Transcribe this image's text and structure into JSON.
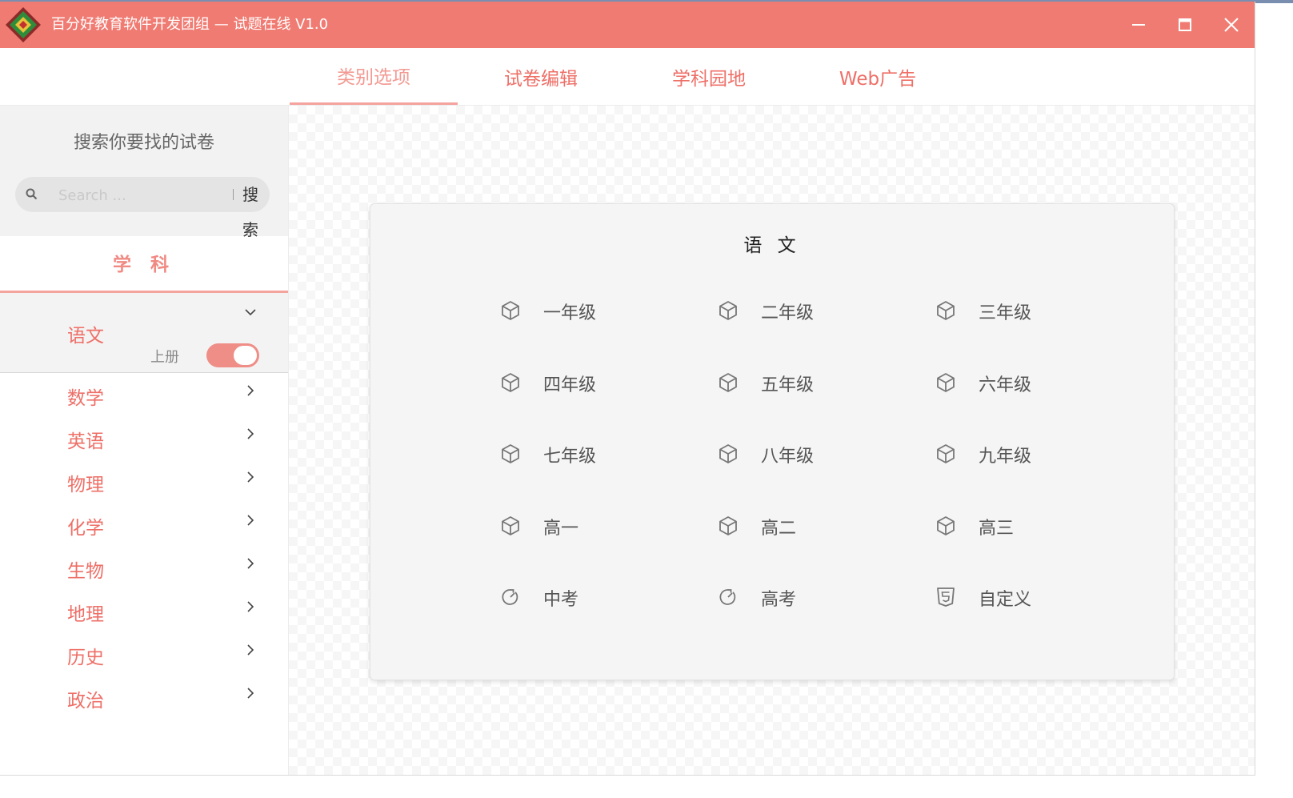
{
  "window": {
    "title": "百分好教育软件开发团组 — 试题在线 V1.0",
    "logo_icon": "diamond-logo-icon",
    "controls": [
      "minimize-icon",
      "maximize-icon",
      "close-icon"
    ]
  },
  "tabs": [
    {
      "label": "类别选项",
      "active": true
    },
    {
      "label": "试卷编辑",
      "active": false
    },
    {
      "label": "学科园地",
      "active": false
    },
    {
      "label": "Web广告",
      "active": false
    }
  ],
  "sidebar": {
    "search_title": "搜索你要找的试卷",
    "search_placeholder": "Search ...",
    "search_button": "搜索",
    "subject_header": "学 科",
    "expanded": {
      "label": "语文",
      "toggle_label": "上册",
      "toggle_on": true
    },
    "items": [
      "数学",
      "英语",
      "物理",
      "化学",
      "生物",
      "地理",
      "历史",
      "政治"
    ]
  },
  "card": {
    "title": "语 文",
    "items": [
      {
        "label": "一年级",
        "icon": "cube-icon"
      },
      {
        "label": "二年级",
        "icon": "cube-icon"
      },
      {
        "label": "三年级",
        "icon": "cube-icon"
      },
      {
        "label": "四年级",
        "icon": "cube-icon"
      },
      {
        "label": "五年级",
        "icon": "cube-icon"
      },
      {
        "label": "六年级",
        "icon": "cube-icon"
      },
      {
        "label": "七年级",
        "icon": "cube-icon"
      },
      {
        "label": "八年级",
        "icon": "cube-icon"
      },
      {
        "label": "九年级",
        "icon": "cube-icon"
      },
      {
        "label": "高一",
        "icon": "cube-icon"
      },
      {
        "label": "高二",
        "icon": "cube-icon"
      },
      {
        "label": "高三",
        "icon": "cube-icon"
      },
      {
        "label": "中考",
        "icon": "refresh-icon"
      },
      {
        "label": "高考",
        "icon": "refresh-icon"
      },
      {
        "label": "自定义",
        "icon": "html5-shield-icon"
      }
    ]
  },
  "colors": {
    "accent": "#f07b72",
    "accent_light": "#f4a39d",
    "text_accent": "#ee6f67"
  }
}
